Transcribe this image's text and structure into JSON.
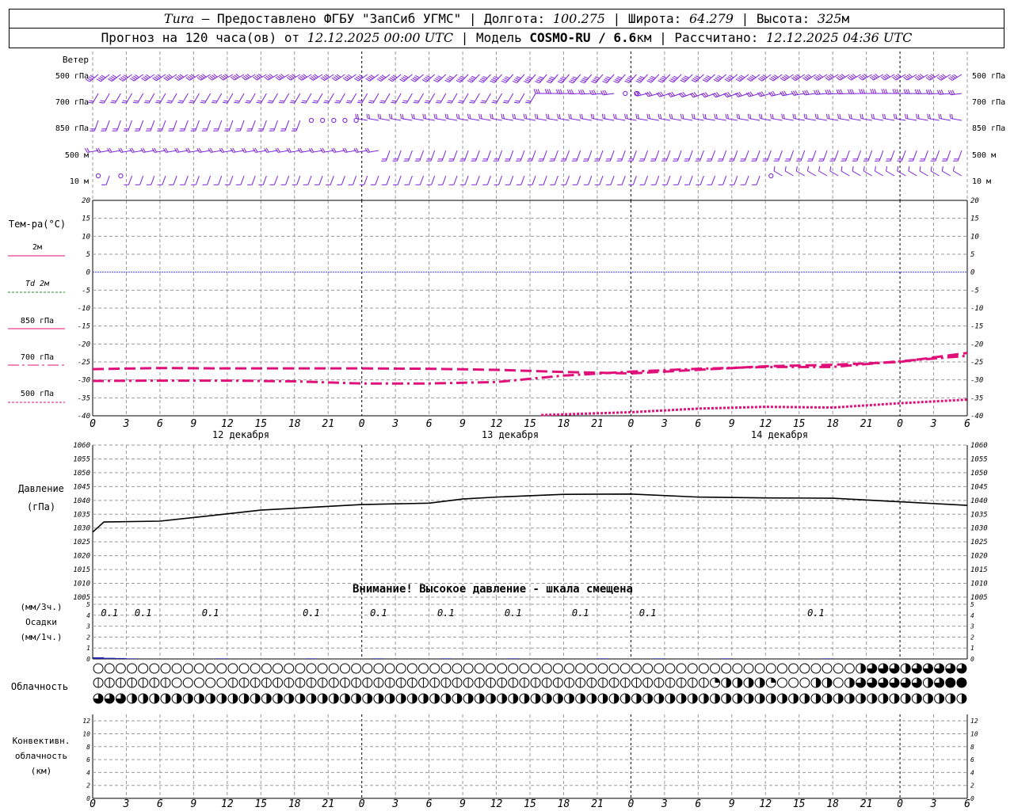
{
  "header": {
    "station": "Tura",
    "provider": " – Предоставлено ФГБУ \"ЗапСиб УГМС\" | Долгота: ",
    "lon": "100.275",
    "lat_label": " | Широта: ",
    "lat": "64.279",
    "alt_label": " | Высота: ",
    "alt": "325",
    "alt_unit": "м",
    "forecast_label": "Прогноз на 120 часа(ов) от ",
    "forecast_from": "12.12.2025 00:00 UTC",
    "model_label": "  | Модель ",
    "model": "COSMO-RU / 6.6",
    "model_unit": "км",
    "calc_label": " | Рассчитано: ",
    "calc_time": "12.12.2025 04:36 UTC"
  },
  "labels": {
    "wind": "Ветер",
    "levels": [
      "500 гПа",
      "700 гПа",
      "850 гПа",
      "500 м",
      "10  м"
    ],
    "temp_title": "Тем-ра(°C)",
    "temp_legend": [
      "2м",
      "Td  2м",
      "850 гПа",
      "700 гПа",
      "500 гПа"
    ],
    "pressure_title": "Давление",
    "pressure_unit": "(гПа)",
    "pressure_warning": "Внимание! Высокое давление - шкала смещена",
    "precip_unit3": "(мм/3ч.)",
    "precip_title": "Осадки",
    "precip_unit1": "(мм/1ч.)",
    "cloud_title": "Облачность",
    "conv_title1": "Конвективн.",
    "conv_title2": "облачность",
    "conv_title3": "(км)",
    "days": [
      "12 декабря",
      "13 декабря",
      "14 декабря"
    ]
  },
  "colors": {
    "wind": "#7b1fd8",
    "temp": "#e0107a",
    "zero_line": "#3a3aff",
    "precip": "#2222aa",
    "grid": "#999999"
  },
  "chart_data": {
    "type": "line",
    "x_hour_labels": [
      "0",
      "3",
      "6",
      "9",
      "12",
      "15",
      "18",
      "21",
      "0",
      "3",
      "6",
      "9",
      "12",
      "15",
      "18",
      "21",
      "0",
      "3",
      "6",
      "9",
      "12",
      "15",
      "18",
      "21",
      "0",
      "3",
      "6"
    ],
    "temperature": {
      "ylim": [
        -40,
        20
      ],
      "yticks": [
        20,
        15,
        10,
        5,
        0,
        -5,
        -10,
        -15,
        -20,
        -25,
        -30,
        -35,
        -40
      ],
      "series": [
        {
          "name": "850 гПа",
          "style": "dash",
          "x": [
            0,
            6,
            12,
            18,
            24,
            30,
            36,
            42,
            48,
            54,
            60,
            66,
            72,
            78
          ],
          "y": [
            -27,
            -26.7,
            -26.8,
            -26.8,
            -26.8,
            -26.9,
            -27.2,
            -27.8,
            -28.2,
            -27.2,
            -26.2,
            -25.8,
            -25,
            -22.5
          ]
        },
        {
          "name": "700 гПа",
          "style": "dashdot",
          "x": [
            0,
            6,
            12,
            18,
            24,
            30,
            36,
            42,
            48,
            54,
            60,
            66,
            72,
            78
          ],
          "y": [
            -30.3,
            -30.2,
            -30.2,
            -30.4,
            -31,
            -31,
            -30.6,
            -28.8,
            -27.7,
            -26.9,
            -26.4,
            -26.4,
            -24.8,
            -23.3
          ]
        },
        {
          "name": "500 гПа",
          "style": "dot",
          "x": [
            40,
            48,
            54,
            60,
            66,
            72,
            78
          ],
          "y": [
            -39.8,
            -39,
            -38,
            -37.5,
            -37.7,
            -36.5,
            -35.5
          ]
        }
      ]
    },
    "pressure": {
      "ylim": [
        1005,
        1060
      ],
      "yticks": [
        1060,
        1055,
        1050,
        1045,
        1040,
        1035,
        1030,
        1025,
        1020,
        1015,
        1010,
        1005
      ],
      "x": [
        0,
        1,
        6,
        9,
        15,
        24,
        30,
        33,
        36,
        42,
        48,
        54,
        60,
        66,
        72,
        78
      ],
      "y": [
        1028.5,
        1032.2,
        1032.5,
        1033.8,
        1036.5,
        1038.5,
        1039,
        1040.5,
        1041.2,
        1042.2,
        1042.3,
        1041.2,
        1040.9,
        1040.8,
        1039.5,
        1038.2
      ]
    },
    "precipitation": {
      "ylim": [
        0,
        5
      ],
      "labels": [
        {
          "x": 1.5,
          "text": "0.1"
        },
        {
          "x": 4.5,
          "text": "0.1"
        },
        {
          "x": 10.5,
          "text": "0.1"
        },
        {
          "x": 19.5,
          "text": "0.1"
        },
        {
          "x": 25.5,
          "text": "0.1"
        },
        {
          "x": 31.5,
          "text": "0.1"
        },
        {
          "x": 37.5,
          "text": "0.1"
        },
        {
          "x": 43.5,
          "text": "0.1"
        },
        {
          "x": 49.5,
          "text": "0.1"
        },
        {
          "x": 64.5,
          "text": "0.1"
        }
      ],
      "bars_x": [
        0,
        1,
        2,
        3,
        11,
        19,
        25,
        31,
        37,
        45,
        50,
        56,
        65
      ],
      "bars_y": [
        0.15,
        0.1,
        0.08,
        0.05,
        0.05,
        0.05,
        0.05,
        0.05,
        0.05,
        0.05,
        0.05,
        0.05,
        0.05
      ]
    },
    "cloud_levels": {
      "note_values": "fraction 0..1 per hour, 78 hourly samples per row",
      "high": [
        0,
        0,
        0,
        0,
        0,
        0,
        0,
        0,
        0,
        0,
        0,
        0,
        0,
        0,
        0,
        0,
        0,
        0,
        0,
        0,
        0,
        0,
        0,
        0,
        0,
        0,
        0,
        0,
        0,
        0,
        0,
        0,
        0,
        0,
        0,
        0,
        0,
        0,
        0,
        0,
        0,
        0,
        0,
        0,
        0,
        0,
        0,
        0,
        0,
        0,
        0,
        0,
        0,
        0,
        0,
        0,
        0,
        0,
        0,
        0,
        0,
        0,
        0,
        0,
        0,
        0,
        0,
        0,
        0.5,
        0.75,
        0.75,
        0.75,
        0.5,
        0.75,
        0.75,
        0.75,
        0.75,
        0.75
      ],
      "mid": [
        0.1,
        0.1,
        0.1,
        0.1,
        0.1,
        0.1,
        0.1,
        0,
        0,
        0,
        0,
        0,
        0.1,
        0.1,
        0.1,
        0.1,
        0.1,
        0.1,
        0.1,
        0.1,
        0.1,
        0.1,
        0.1,
        0.1,
        0.1,
        0.1,
        0.1,
        0.1,
        0.1,
        0.1,
        0.1,
        0.1,
        0.1,
        0.1,
        0.1,
        0.1,
        0.1,
        0.1,
        0.1,
        0.1,
        0.1,
        0.1,
        0.1,
        0.1,
        0.1,
        0.1,
        0.1,
        0.1,
        0.1,
        0.1,
        0.1,
        0.1,
        0.1,
        0.1,
        0.1,
        0.25,
        0.5,
        0.5,
        0.5,
        0.5,
        0.25,
        0,
        0,
        0,
        0.5,
        0.5,
        0,
        0.5,
        0.75,
        0.75,
        0.75,
        0.75,
        0.75,
        0.75,
        0.5,
        0.75,
        1,
        1
      ],
      "low": [
        0.75,
        0.75,
        0.75,
        0.5,
        0.5,
        0.5,
        0.5,
        0.5,
        0.5,
        0.5,
        0.5,
        0.5,
        0.5,
        0.5,
        0.5,
        0.5,
        0.5,
        0.5,
        0.5,
        0.5,
        0.5,
        0.5,
        0.5,
        0.5,
        0.5,
        0.5,
        0.5,
        0.5,
        0.5,
        0.5,
        0.5,
        0.5,
        0.5,
        0.5,
        0.5,
        0.5,
        0.5,
        0.5,
        0.5,
        0.5,
        0.5,
        0.5,
        0.5,
        0.5,
        0.5,
        0.5,
        0.5,
        0.5,
        0.5,
        0.5,
        0.5,
        0.5,
        0.5,
        0.5,
        0.5,
        0.5,
        0.5,
        0.5,
        0.5,
        0.5,
        0.5,
        0.5,
        0.5,
        0.5,
        0.5,
        0.5,
        0.5,
        0.5,
        0.5,
        0.5,
        0.5,
        0.5,
        0.5,
        0.5,
        0.5,
        0.5,
        0.5,
        0.5
      ]
    },
    "convective_cloud": {
      "ylim": [
        0,
        13
      ],
      "yticks": [
        12,
        10,
        8,
        6,
        4,
        2,
        0
      ],
      "values": []
    },
    "wind_rows": {
      "calm_marks": [
        {
          "level": "700 гПа",
          "x": [
            47,
            48
          ]
        },
        {
          "level": "850 гПа",
          "x": [
            19,
            20,
            21,
            22,
            23
          ]
        },
        {
          "level": "10  м",
          "x": [
            0,
            2,
            60
          ]
        }
      ]
    }
  }
}
